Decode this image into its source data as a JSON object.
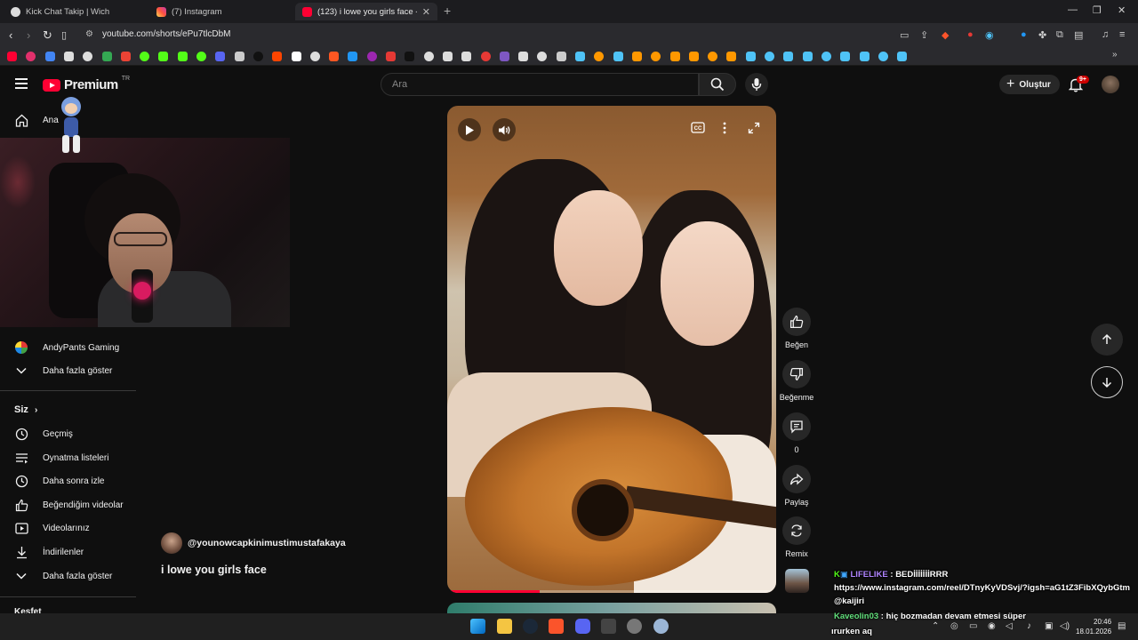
{
  "browser": {
    "tabs": [
      {
        "title": "Kick Chat Takip | Wich",
        "active": false
      },
      {
        "title": "(7) Instagram",
        "active": false
      },
      {
        "title": "(123) i lowe you girls face - YouT",
        "active": true
      }
    ],
    "url": "youtube.com/shorts/ePu7tlcDbM"
  },
  "yt": {
    "logo": "Premium",
    "region": "TR",
    "search_placeholder": "Ara",
    "create_label": "Oluştur",
    "notifications_badge": "9+"
  },
  "sidebar": {
    "home_label": "Ana",
    "subscription_items": [
      {
        "label": "AndyPants Gaming"
      },
      {
        "label": "Daha fazla göster"
      }
    ],
    "you_section": "Siz",
    "you_items": [
      {
        "label": "Geçmiş",
        "icon": "history-icon"
      },
      {
        "label": "Oynatma listeleri",
        "icon": "playlist-icon"
      },
      {
        "label": "Daha sonra izle",
        "icon": "clock-icon"
      },
      {
        "label": "Beğendiğim videolar",
        "icon": "thumbs-up-icon"
      },
      {
        "label": "Videolarınız",
        "icon": "your-videos-icon"
      },
      {
        "label": "İndirilenler",
        "icon": "download-icon"
      },
      {
        "label": "Daha fazla göster",
        "icon": "chevron-down-icon"
      }
    ],
    "explore_section": "Keşfet"
  },
  "short": {
    "channel_handle": "@younowcapkinimustimustafakaya",
    "title": "i lowe you girls face",
    "progress_fraction": 0.28,
    "actions": {
      "like": "Beğen",
      "dislike": "Beğenme",
      "comments": "0",
      "share": "Paylaş",
      "remix": "Remix"
    }
  },
  "chat": [
    {
      "user": "LIFELIKE",
      "message": "BEDİİİİİİİRRR"
    },
    {
      "user": "",
      "message": "https://www.instagram.com/reel/DTnyKyVDSvj/?igsh=aG1tZ3FibXQybGtm"
    },
    {
      "user": "",
      "message": "@kaijiri"
    },
    {
      "user": "Kaveolin03",
      "message": "hiç bozmadan devam etmesi süper"
    },
    {
      "user": "",
      "message": "ırurken aq"
    }
  ],
  "taskbar": {
    "time": "20:46",
    "date": "18.01.2026"
  },
  "colors": {
    "accent": "#ff0033",
    "background": "#0f0f0f",
    "kick_green": "#53fc18"
  }
}
